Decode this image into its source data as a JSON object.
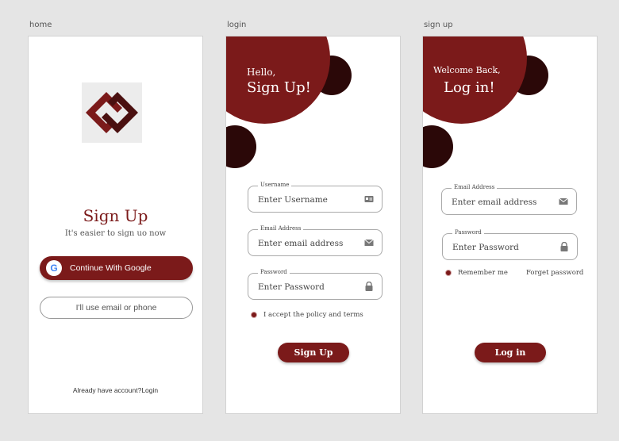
{
  "artboards": {
    "home_label": "home",
    "login_label": "login",
    "signup_label": "sign up"
  },
  "home": {
    "title": "Sign Up",
    "subtitle": "It's easier to sign uo now",
    "google_button": "Continue With Google",
    "google_letter": "G",
    "email_button": "I'll use email or phone",
    "footer": "Already have account?Login"
  },
  "login": {
    "greeting": "Hello,",
    "heading": "Sign Up!",
    "username_label": "Username",
    "username_value": "Enter Username",
    "email_label": "Email Address",
    "email_value": "Enter email address",
    "password_label": "Password",
    "password_value": "Enter Password",
    "accept_text": "I accept the policy and terms",
    "submit": "Sign Up"
  },
  "signup": {
    "greeting": "Welcome Back,",
    "heading": "Log in!",
    "email_label": "Email Address",
    "email_value": "Enter email address",
    "password_label": "Password",
    "password_value": "Enter Password",
    "remember": "Remember me",
    "forget": "Forget password",
    "submit": "Log in"
  },
  "icons": {
    "logo": "interlocked-diamond-logo",
    "google": "google-icon",
    "id_card": "id-card-icon",
    "mail": "mail-icon",
    "lock": "lock-icon"
  },
  "colors": {
    "brand": "#7b1a1a",
    "brand_dark": "#2b0808",
    "canvas": "#e5e5e5"
  }
}
